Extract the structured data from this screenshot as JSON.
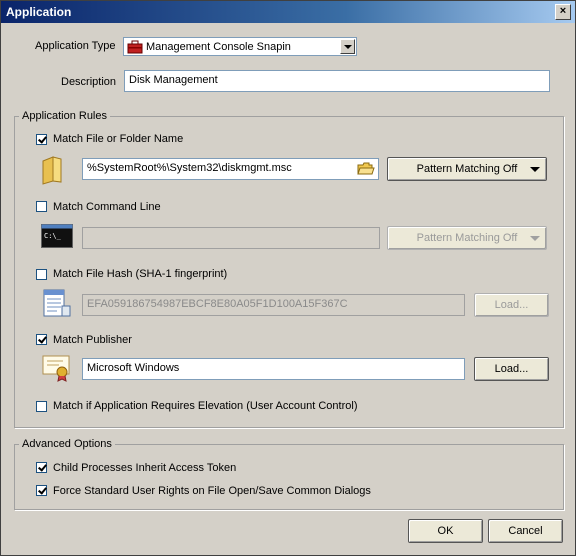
{
  "window": {
    "title": "Application",
    "close_label": "×"
  },
  "app_type": {
    "label": "Application Type",
    "value": "Management Console Snapin"
  },
  "description": {
    "label": "Description",
    "value": "Disk Management"
  },
  "rules": {
    "title": "Application Rules",
    "file": {
      "label": "Match File or Folder Name",
      "checked": true,
      "value": "%SystemRoot%\\System32\\diskmgmt.msc",
      "pattern": "Pattern Matching Off"
    },
    "cmd": {
      "label": "Match Command Line",
      "checked": false,
      "value": "",
      "pattern": "Pattern Matching Off"
    },
    "hash": {
      "label": "Match File Hash (SHA-1 fingerprint)",
      "checked": false,
      "value": "EFA059186754987EBCF8E80A05F1D100A15F367C",
      "load": "Load..."
    },
    "publisher": {
      "label": "Match Publisher",
      "checked": true,
      "value": "Microsoft Windows",
      "load": "Load..."
    },
    "elevation": {
      "label": "Match if Application Requires Elevation (User Account Control)",
      "checked": false
    }
  },
  "advanced": {
    "title": "Advanced Options",
    "inherit": {
      "label": "Child Processes Inherit Access Token",
      "checked": true
    },
    "force": {
      "label": "Force Standard User Rights on File Open/Save Common Dialogs",
      "checked": true
    }
  },
  "buttons": {
    "ok": "OK",
    "cancel": "Cancel"
  },
  "icons": {
    "file": "folder-icon",
    "cmd": "console-icon",
    "hash": "document-hash-icon",
    "publisher": "certificate-icon",
    "apptype": "toolbox-icon"
  }
}
